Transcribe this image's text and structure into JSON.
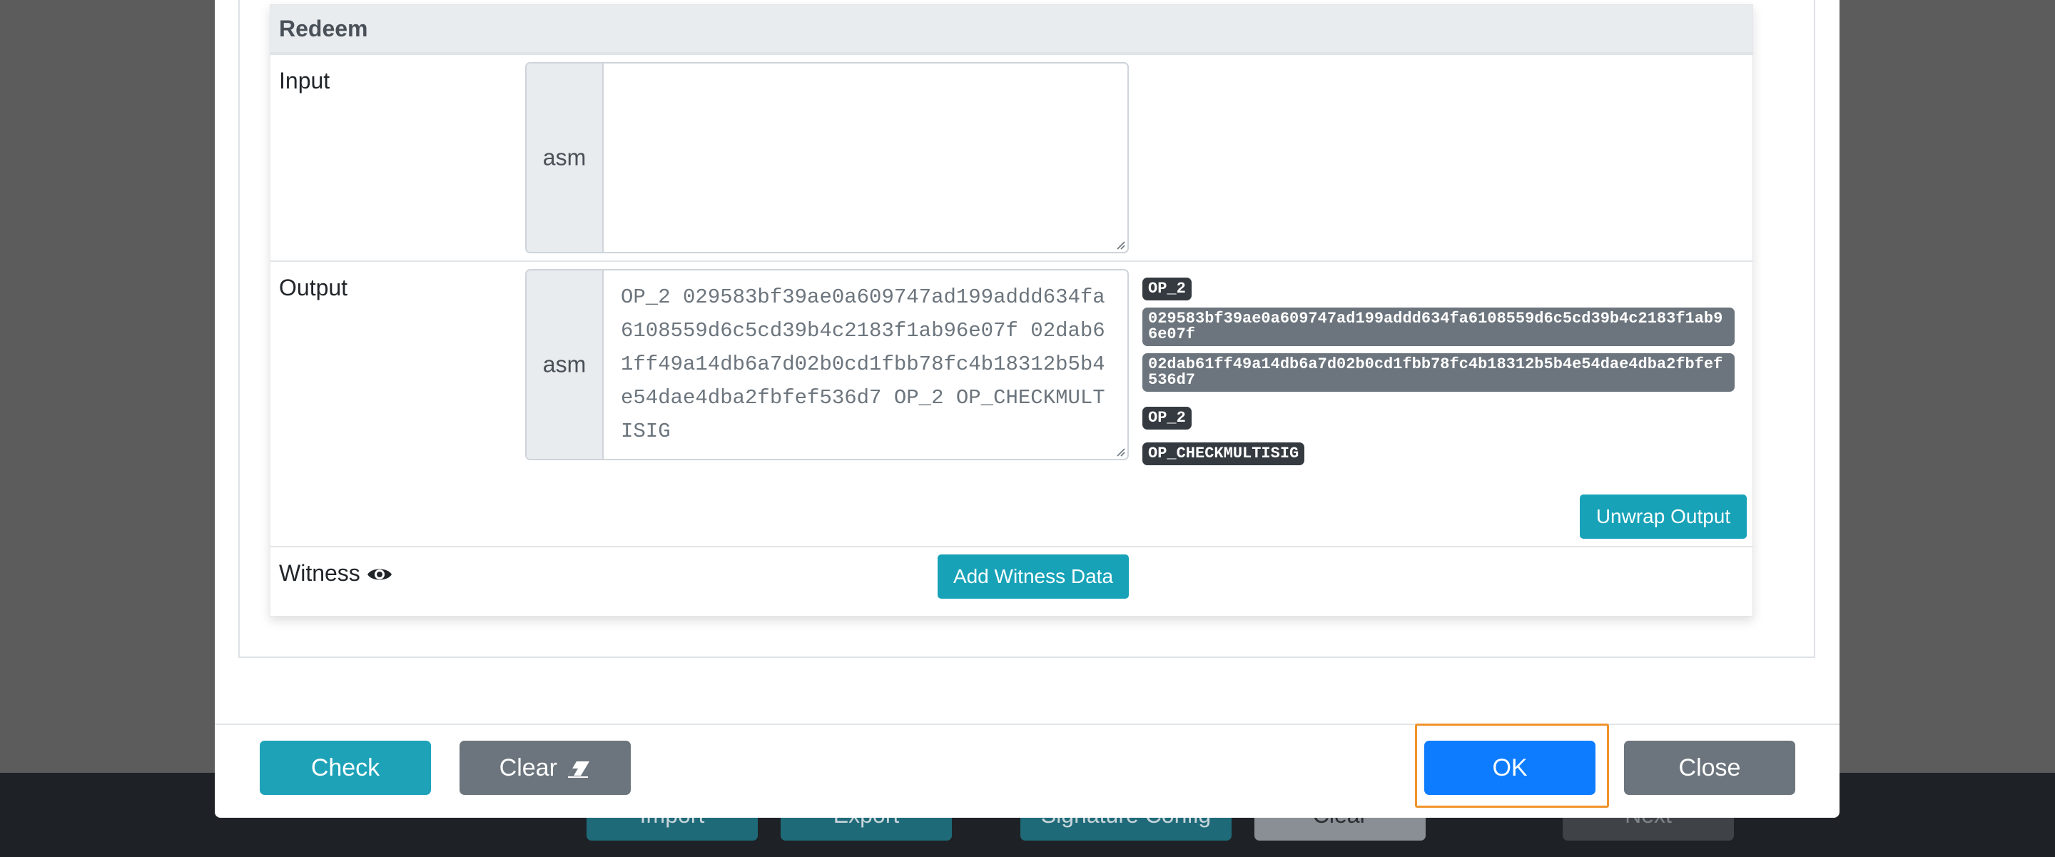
{
  "background_toolbar": {
    "buttons": [
      "Import",
      "Export",
      "Signature Config",
      "Clear",
      "Next"
    ]
  },
  "redeem": {
    "title": "Redeem",
    "input": {
      "label": "Input",
      "addon": "asm",
      "value": ""
    },
    "output": {
      "label": "Output",
      "addon": "asm",
      "value": "OP_2 029583bf39ae0a609747ad199addd634fa6108559d6c5cd39b4c2183f1ab96e07f 02dab61ff49a14db6a7d02b0cd1fbb78fc4b18312b5b4e54dae4dba2fbfef536d7 OP_2 OP_CHECKMULTISIG",
      "tokens": [
        "OP_2",
        "029583bf39ae0a609747ad199addd634fa6108559d6c5cd39b4c2183f1ab96e07f",
        "02dab61ff49a14db6a7d02b0cd1fbb78fc4b18312b5b4e54dae4dba2fbfef536d7",
        "OP_2",
        "OP_CHECKMULTISIG"
      ],
      "unwrap_button": "Unwrap Output"
    },
    "witness": {
      "label": "Witness",
      "add_button": "Add Witness Data"
    }
  },
  "footer": {
    "check": "Check",
    "clear": "Clear",
    "ok": "OK",
    "close": "Close"
  },
  "colors": {
    "info": "#17a2b8",
    "primary": "#0d7cff",
    "secondary": "#6c757d",
    "focus": "#f0932b"
  }
}
